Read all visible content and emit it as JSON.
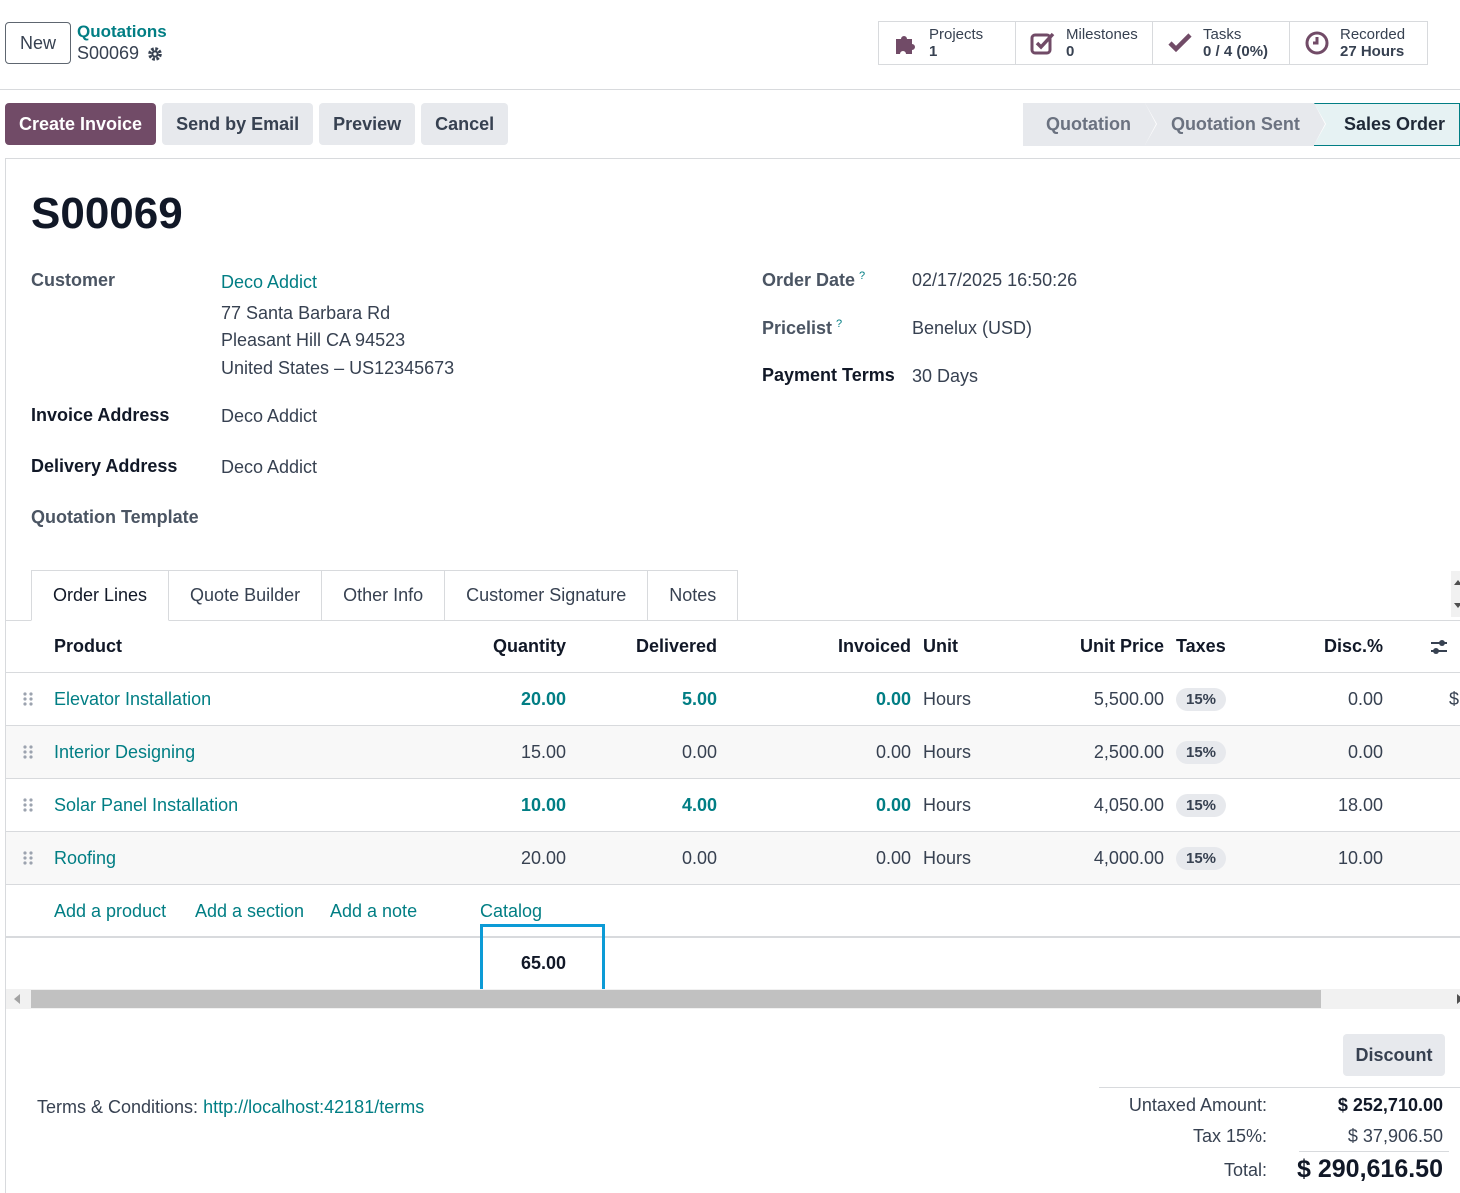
{
  "control_panel": {
    "new_label": "New",
    "breadcrumb_parent": "Quotations",
    "breadcrumb_current": "S00069",
    "smart_buttons": [
      {
        "label": "Projects",
        "value": "1",
        "icon": "puzzle-icon"
      },
      {
        "label": "Milestones",
        "value": "0",
        "icon": "checkbox-icon"
      },
      {
        "label": "Tasks",
        "value": "0 / 4 (0%)",
        "icon": "check-icon"
      },
      {
        "label": "Recorded",
        "value": "27 Hours",
        "icon": "clock-icon"
      }
    ]
  },
  "statusbar": {
    "actions": [
      "Create Invoice",
      "Send by Email",
      "Preview",
      "Cancel"
    ],
    "stages": [
      "Quotation",
      "Quotation Sent",
      "Sales Order"
    ],
    "active_stage": "Sales Order"
  },
  "form": {
    "title": "S00069",
    "customer_label": "Customer",
    "customer_name": "Deco Addict",
    "customer_address": [
      "77 Santa Barbara Rd",
      "Pleasant Hill CA 94523",
      "United States – US12345673"
    ],
    "invoice_address_label": "Invoice Address",
    "invoice_address": "Deco Addict",
    "delivery_address_label": "Delivery Address",
    "delivery_address": "Deco Addict",
    "quotation_template_label": "Quotation Template",
    "order_date_label": "Order Date",
    "order_date": "02/17/2025 16:50:26",
    "pricelist_label": "Pricelist",
    "pricelist": "Benelux (USD)",
    "payment_terms_label": "Payment Terms",
    "payment_terms": "30 Days",
    "help_mark": "?"
  },
  "tabs": [
    "Order Lines",
    "Quote Builder",
    "Other Info",
    "Customer Signature",
    "Notes"
  ],
  "table": {
    "headers": {
      "product": "Product",
      "quantity": "Quantity",
      "delivered": "Delivered",
      "invoiced": "Invoiced",
      "unit": "Unit",
      "unit_price": "Unit Price",
      "taxes": "Taxes",
      "disc": "Disc.%"
    },
    "rows": [
      {
        "product": "Elevator Installation",
        "quantity": "20.00",
        "delivered": "5.00",
        "invoiced": "0.00",
        "unit": "Hours",
        "unit_price": "5,500.00",
        "taxes": "15%",
        "disc": "0.00",
        "more": "$"
      },
      {
        "product": "Interior Designing",
        "quantity": "15.00",
        "delivered": "0.00",
        "invoiced": "0.00",
        "unit": "Hours",
        "unit_price": "2,500.00",
        "taxes": "15%",
        "disc": "0.00",
        "more": ""
      },
      {
        "product": "Solar Panel Installation",
        "quantity": "10.00",
        "delivered": "4.00",
        "invoiced": "0.00",
        "unit": "Hours",
        "unit_price": "4,050.00",
        "taxes": "15%",
        "disc": "18.00",
        "more": ""
      },
      {
        "product": "Roofing",
        "quantity": "20.00",
        "delivered": "0.00",
        "invoiced": "0.00",
        "unit": "Hours",
        "unit_price": "4,000.00",
        "taxes": "15%",
        "disc": "10.00",
        "more": ""
      }
    ],
    "add_links": [
      "Add a product",
      "Add a section",
      "Add a note",
      "Catalog"
    ],
    "quantity_total": "65.00"
  },
  "footer": {
    "discount_label": "Discount",
    "terms_label": "Terms & Conditions:",
    "terms_link": "http://localhost:42181/terms",
    "untaxed_label": "Untaxed Amount:",
    "untaxed_value": "$ 252,710.00",
    "tax_label": "Tax 15%:",
    "tax_value": "$ 37,906.50",
    "total_label": "Total:",
    "total_value": "$ 290,616.50"
  },
  "colors": {
    "primary": "#714b67",
    "link": "#017e84",
    "focus": "#0c9bd6"
  }
}
